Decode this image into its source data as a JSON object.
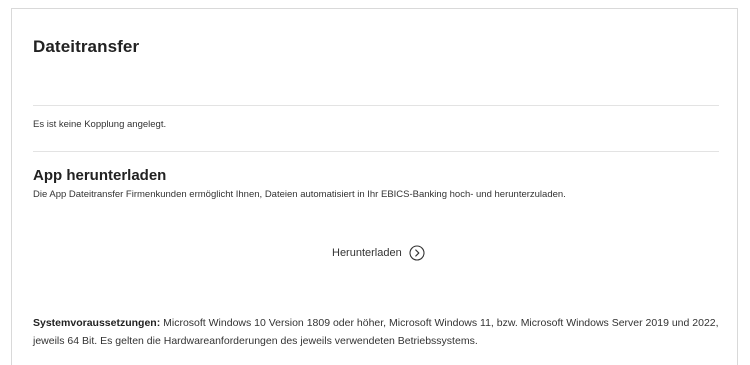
{
  "page": {
    "title": "Dateitransfer"
  },
  "coupling": {
    "status_text": "Es ist keine Kopplung angelegt."
  },
  "app_section": {
    "title": "App herunterladen",
    "description": "Die App Dateitransfer Firmenkunden ermöglicht Ihnen, Dateien automatisiert in Ihr EBICS-Banking hoch- und herunterzuladen.",
    "download_label": "Herunterladen",
    "download_icon": "chevron-right-circle-icon"
  },
  "requirements": {
    "label": "Systemvoraussetzungen:",
    "text": " Microsoft Windows 10 Version 1809 oder höher, Microsoft Windows 11, bzw. Microsoft Windows Server 2019 und 2022, jeweils 64 Bit. Es gelten die Hardwareanforderungen des jeweils verwendeten Betriebssystems."
  },
  "colors": {
    "text": "#333333",
    "heading": "#222222",
    "divider": "#e3e3e3",
    "border": "#d9d9d9"
  }
}
